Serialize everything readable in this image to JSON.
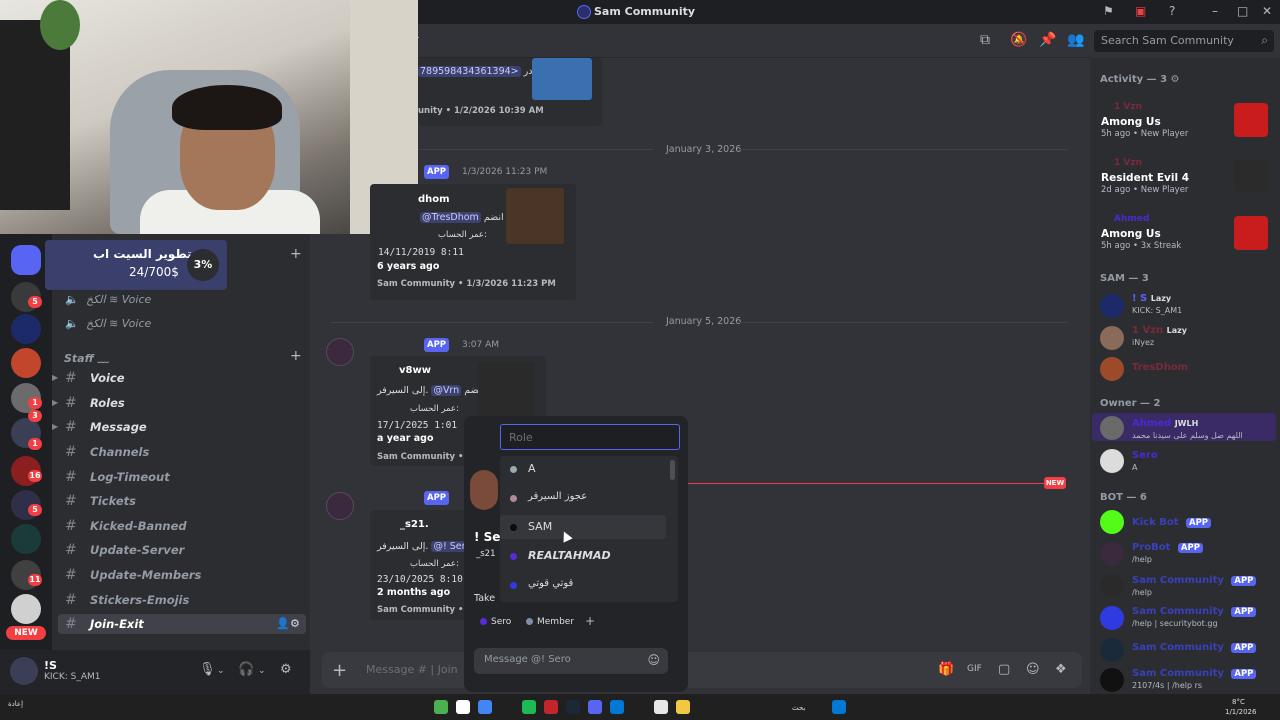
{
  "window": {
    "title": "Sam Community",
    "header_tag": "r"
  },
  "goal": {
    "title": "تطوير السيت اب",
    "amount": "24/700$",
    "percent": "3%"
  },
  "channels": {
    "voice": [
      {
        "label": "الكخ ≋ Voice"
      },
      {
        "label": "الكخ ≋ Voice"
      }
    ],
    "category": "Staff ﹏",
    "text": [
      {
        "label": "Voice"
      },
      {
        "label": "Roles"
      },
      {
        "label": "Message"
      },
      {
        "label": "Channels"
      },
      {
        "label": "Log-Timeout"
      },
      {
        "label": "Tickets"
      },
      {
        "label": "Kicked-Banned"
      },
      {
        "label": "Update-Server"
      },
      {
        "label": "Update-Members"
      },
      {
        "label": "Stickers-Emojis"
      },
      {
        "label": "Join-Exit"
      }
    ]
  },
  "guild_badges": [
    "5",
    "1",
    "3",
    "1",
    "2",
    "16",
    "5",
    "11"
  ],
  "guild_new": "NEW",
  "user": {
    "name": "!S",
    "status": "KICK: S_AM1"
  },
  "search": {
    "placeholder": "Search Sam Community"
  },
  "messages": {
    "dates": [
      "January 3, 2026",
      "January 5, 2026"
    ],
    "m0": {
      "mention": "789598434361394>",
      "arabic": "غادر",
      "footer": "unity • 1/2/2026 10:39 AM"
    },
    "m1": {
      "app": "APP",
      "time": "1/3/2026 11:23 PM",
      "name": "dhom",
      "mention": "@TresDhom",
      "join": "انضم",
      "sub": "عمر الحساب:",
      "date": "14/11/2019 8:11",
      "ago": "6 years ago",
      "footer": "Sam Community • 1/3/2026 11:23 PM"
    },
    "m2": {
      "app": "APP",
      "time": "3:07 AM",
      "name": "v8ww",
      "mention": "@Vrn",
      "join": "انضم",
      "to": "إلى السيرفر.",
      "sub": "عمر الحساب:",
      "date": "17/1/2025 1:01",
      "ago": "a year ago",
      "footer": "Sam Community • Tod"
    },
    "m3": {
      "app": "APP",
      "name": "_s21.",
      "mention": "@! Sero",
      "join": "انضم",
      "to": "إلى السيرفر.",
      "sub": "عمر الحساب:",
      "date": "23/10/2025 8:10",
      "ago": "2 months ago",
      "footer": "Sam Community • Tod",
      "take": "Take",
      "side_title": "! Se",
      "side_sub": "_s21"
    },
    "new": "NEW"
  },
  "composer": {
    "placeholder": "Message # |  Join"
  },
  "role_popup": {
    "placeholder": "Role",
    "roles": [
      {
        "label": "A",
        "color": "#99aab5"
      },
      {
        "label": "عجوز السيرفر",
        "color": "#b08a9c"
      },
      {
        "label": "SAM",
        "color": "#0a0a14"
      },
      {
        "label": "REALTAHMAD",
        "color": "#5b2ad8"
      },
      {
        "label": "قوتي قوتي",
        "color": "#2f3be0"
      }
    ],
    "member_roles": [
      {
        "label": "Sero",
        "color": "#5b2ad8"
      },
      {
        "label": "Member",
        "color": "#7d8fa8"
      }
    ],
    "message_placeholder": "Message @! Sero"
  },
  "members": {
    "activity_header": "Activity — 3",
    "activities": [
      {
        "user": "1 Vzn",
        "game": "Among Us",
        "sub": "5h ago • New Player"
      },
      {
        "user": "1 Vzn",
        "game": "Resident Evil 4",
        "sub": "2d ago • New Player"
      },
      {
        "user": "Ahmed",
        "game": "Among Us",
        "sub": "5h ago • 3x Streak"
      }
    ],
    "sam_header": "SAM — 3",
    "sam": [
      {
        "name": "! S",
        "tag": "Lazy",
        "sub": "KICK: S_AM1",
        "color": "#5865f2"
      },
      {
        "name": "1 Vzn",
        "tag": "Lazy",
        "sub": "iNyez",
        "color": "#7b2a3a"
      },
      {
        "name": "TresDhom",
        "tag": "",
        "sub": "",
        "color": "#7b2a3a"
      }
    ],
    "owner_header": "Owner — 2",
    "owners": [
      {
        "name": "Ahmed",
        "tag": "JWLH",
        "sub": "اللهم صل وسلم على سيدنا محمد",
        "color": "#4a2ad0"
      },
      {
        "name": "Sero",
        "tag": "",
        "sub": "A",
        "color": "#4a2ad0"
      }
    ],
    "bot_header": "BOT — 6",
    "bots": [
      {
        "name": "Kick Bot",
        "sub": "",
        "app": "APP",
        "color": "#3a40b8"
      },
      {
        "name": "ProBot",
        "sub": "/help",
        "app": "APP",
        "color": "#3a40b8"
      },
      {
        "name": "Sam Community",
        "sub": "/help",
        "app": "APP",
        "color": "#3a40b8"
      },
      {
        "name": "Sam Community",
        "sub": "/help | securitybot.gg",
        "app": "APP",
        "color": "#3a40b8"
      },
      {
        "name": "Sam Community",
        "sub": "/help",
        "app": "APP",
        "color": "#3a40b8"
      },
      {
        "name": "Sam Community",
        "sub": "2107/4s | /help rs",
        "app": "APP",
        "color": "#3a40b8"
      }
    ]
  },
  "taskbar": {
    "left_text": "إعادة",
    "search_label": "بحث",
    "weather": "8°C",
    "clock": "1/1/2026"
  }
}
